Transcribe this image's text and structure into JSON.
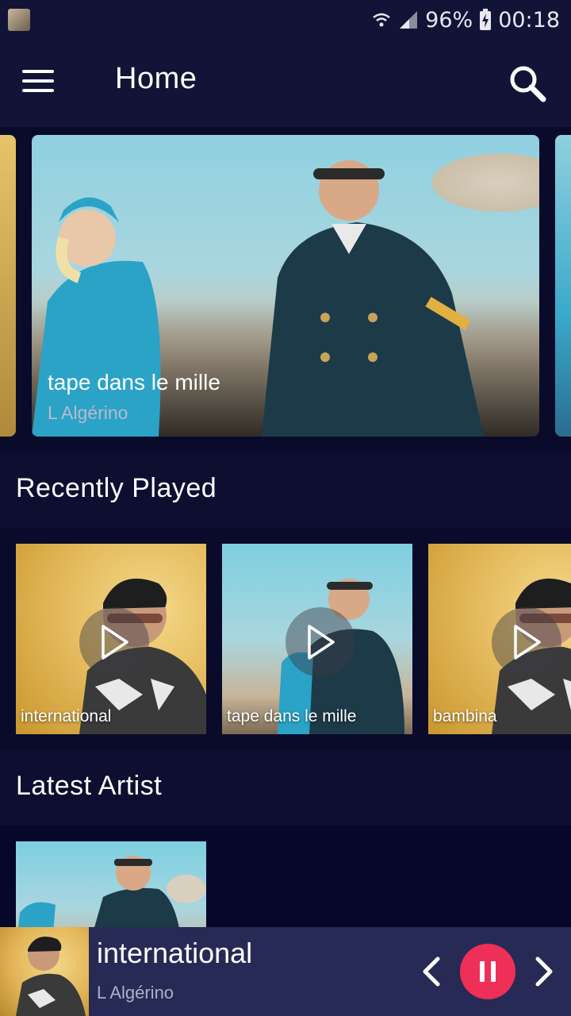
{
  "status": {
    "battery": "96%",
    "time": "00:18"
  },
  "header": {
    "title": "Home"
  },
  "featured": {
    "title": "tape dans le mille",
    "artist": "L Algérino"
  },
  "recently_played": {
    "heading": "Recently Played",
    "items": [
      {
        "label": "international"
      },
      {
        "label": "tape dans le mille"
      },
      {
        "label": "bambina"
      }
    ]
  },
  "latest_artist": {
    "heading": "Latest Artist"
  },
  "player": {
    "title": "international",
    "artist": "L Algérino"
  },
  "colors": {
    "background": "#0c0d2e",
    "bar": "#121437",
    "player_bar": "#272a55",
    "accent": "#ee2f58"
  }
}
